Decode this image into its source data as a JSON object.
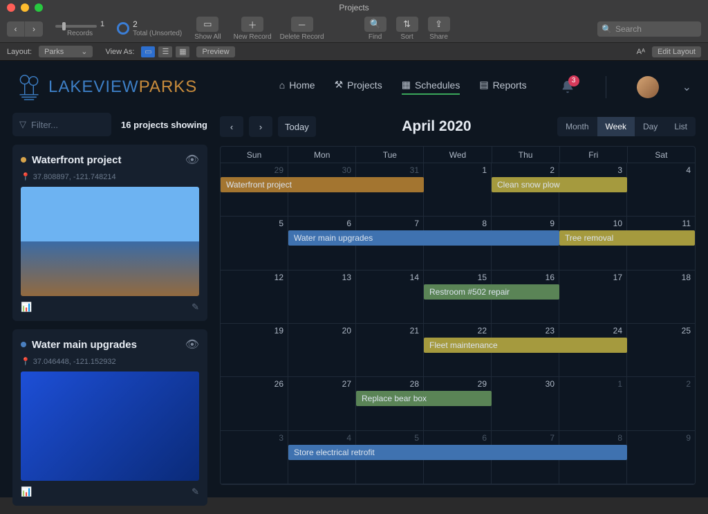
{
  "window": {
    "title": "Projects"
  },
  "toolbar": {
    "records_label": "Records",
    "records_index": "1",
    "total_count": "2",
    "total_label": "Total (Unsorted)",
    "showall": "Show All",
    "new_record": "New Record",
    "delete_record": "Delete Record",
    "find": "Find",
    "sort": "Sort",
    "share": "Share",
    "search_placeholder": "Search"
  },
  "layoutbar": {
    "layout_label": "Layout:",
    "layout_value": "Parks",
    "view_as": "View As:",
    "preview": "Preview",
    "aa": "Aᴬ",
    "edit_layout": "Edit Layout"
  },
  "brand": {
    "part1": "LAKEVIEW",
    "part2": "PARKS"
  },
  "nav": {
    "home": "Home",
    "projects": "Projects",
    "schedules": "Schedules",
    "reports": "Reports"
  },
  "notifications": {
    "count": "3"
  },
  "filter": {
    "placeholder": "Filter...",
    "status": "16 projects showing"
  },
  "cards": [
    {
      "title": "Waterfront project",
      "dotColor": "#d7a44b",
      "coords": "37.808897, -121.748214"
    },
    {
      "title": "Water main upgrades",
      "dotColor": "#4a7fbf",
      "coords": "37.046448, -121.152932"
    }
  ],
  "calendar": {
    "today": "Today",
    "title": "April 2020",
    "views": [
      "Month",
      "Week",
      "Day",
      "List"
    ],
    "active_view": "Week",
    "day_headers": [
      "Sun",
      "Mon",
      "Tue",
      "Wed",
      "Thu",
      "Fri",
      "Sat"
    ],
    "rows": 6,
    "cells": [
      [
        {
          "n": "29",
          "off": true
        },
        {
          "n": "30",
          "off": true
        },
        {
          "n": "31",
          "off": true
        },
        {
          "n": "1"
        },
        {
          "n": "2"
        },
        {
          "n": "3"
        },
        {
          "n": "4"
        }
      ],
      [
        {
          "n": "5"
        },
        {
          "n": "6"
        },
        {
          "n": "7"
        },
        {
          "n": "8"
        },
        {
          "n": "9"
        },
        {
          "n": "10"
        },
        {
          "n": "11"
        }
      ],
      [
        {
          "n": "12"
        },
        {
          "n": "13"
        },
        {
          "n": "14"
        },
        {
          "n": "15"
        },
        {
          "n": "16"
        },
        {
          "n": "17"
        },
        {
          "n": "18"
        }
      ],
      [
        {
          "n": "19"
        },
        {
          "n": "20"
        },
        {
          "n": "21"
        },
        {
          "n": "22"
        },
        {
          "n": "23"
        },
        {
          "n": "24"
        },
        {
          "n": "25"
        }
      ],
      [
        {
          "n": "26"
        },
        {
          "n": "27"
        },
        {
          "n": "28"
        },
        {
          "n": "29"
        },
        {
          "n": "30"
        },
        {
          "n": "1",
          "off": true
        },
        {
          "n": "2",
          "off": true
        }
      ],
      [
        {
          "n": "3",
          "off": true
        },
        {
          "n": "4",
          "off": true
        },
        {
          "n": "5",
          "off": true
        },
        {
          "n": "6",
          "off": true
        },
        {
          "n": "7",
          "off": true
        },
        {
          "n": "8",
          "off": true
        },
        {
          "n": "9",
          "off": true
        }
      ]
    ],
    "events": [
      {
        "label": "Waterfront project",
        "row": 0,
        "startCol": 0,
        "span": 3,
        "color": "#a37530"
      },
      {
        "label": "Clean snow plow",
        "row": 0,
        "startCol": 4,
        "span": 2,
        "color": "#a59a3e"
      },
      {
        "label": "Water main upgrades",
        "row": 1,
        "startCol": 1,
        "span": 4,
        "color": "#3f72b0"
      },
      {
        "label": "Tree removal",
        "row": 1,
        "startCol": 5,
        "span": 2,
        "color": "#a59a3e"
      },
      {
        "label": "Restroom #502 repair",
        "row": 2,
        "startCol": 3,
        "span": 2,
        "color": "#5a8456"
      },
      {
        "label": "Fleet maintenance",
        "row": 3,
        "startCol": 3,
        "span": 3,
        "color": "#a59a3e"
      },
      {
        "label": "Replace bear box",
        "row": 4,
        "startCol": 2,
        "span": 2,
        "color": "#5a8456"
      },
      {
        "label": "Store electrical retrofit",
        "row": 5,
        "startCol": 1,
        "span": 5,
        "color": "#3f72b0"
      }
    ]
  }
}
